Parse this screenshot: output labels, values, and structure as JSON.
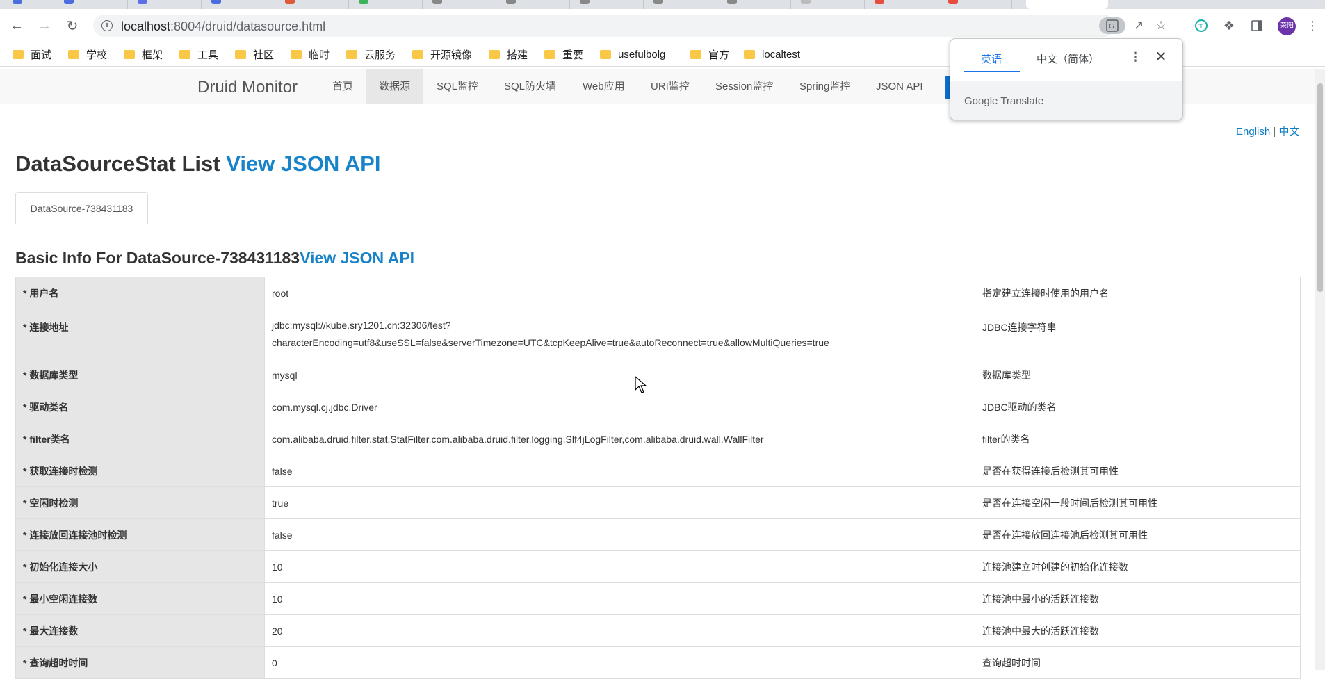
{
  "browser": {
    "url_host": "localhost",
    "url_rest": ":8004/druid/datasource.html",
    "profile_initials": "荣阳"
  },
  "bookmarks": [
    "面试",
    "学校",
    "框架",
    "工具",
    "社区",
    "临时",
    "云服务",
    "开源镜像",
    "搭建",
    "重要",
    "usefulbolg",
    "官方",
    "localtest"
  ],
  "druid_nav": {
    "brand": "Druid Monitor",
    "items": [
      "首页",
      "数据源",
      "SQL监控",
      "SQL防火墙",
      "Web应用",
      "URI监控",
      "Session监控",
      "Spring监控",
      "JSON API"
    ],
    "active_index": 1
  },
  "lang": {
    "english": "English",
    "sep": " | ",
    "chinese": "中文"
  },
  "page": {
    "title": "DataSourceStat List ",
    "title_link": "View JSON API",
    "datasource_tab": "DataSource-738431183",
    "subtitle": "Basic Info For DataSource-738431183",
    "subtitle_link": "View JSON API"
  },
  "rows": [
    {
      "label": "* 用户名",
      "value": "root",
      "desc": "指定建立连接时使用的用户名"
    },
    {
      "label": "* 连接地址",
      "value": "jdbc:mysql://kube.sry1201.cn:32306/test?",
      "value2": "characterEncoding=utf8&useSSL=false&serverTimezone=UTC&tcpKeepAlive=true&autoReconnect=true&allowMultiQueries=true",
      "desc": "JDBC连接字符串"
    },
    {
      "label": "* 数据库类型",
      "value": "mysql",
      "desc": "数据库类型"
    },
    {
      "label": "* 驱动类名",
      "value": "com.mysql.cj.jdbc.Driver",
      "desc": "JDBC驱动的类名"
    },
    {
      "label": "* filter类名",
      "value": "com.alibaba.druid.filter.stat.StatFilter,com.alibaba.druid.filter.logging.Slf4jLogFilter,com.alibaba.druid.wall.WallFilter",
      "desc": "filter的类名"
    },
    {
      "label": "* 获取连接时检测",
      "value": "false",
      "desc": "是否在获得连接后检测其可用性"
    },
    {
      "label": "* 空闲时检测",
      "value": "true",
      "desc": "是否在连接空闲一段时间后检测其可用性"
    },
    {
      "label": "* 连接放回连接池时检测",
      "value": "false",
      "desc": "是否在连接放回连接池后检测其可用性"
    },
    {
      "label": "* 初始化连接大小",
      "value": "10",
      "desc": "连接池建立时创建的初始化连接数"
    },
    {
      "label": "* 最小空闲连接数",
      "value": "10",
      "desc": "连接池中最小的活跃连接数"
    },
    {
      "label": "* 最大连接数",
      "value": "20",
      "desc": "连接池中最大的活跃连接数"
    },
    {
      "label": "* 查询超时时间",
      "value": "0",
      "desc": "查询超时时间"
    }
  ],
  "translate_popup": {
    "tab_source": "英语",
    "tab_target": "中文（简体）",
    "brand": "Google Translate"
  },
  "colors": {
    "link": "#1883c9",
    "nav_active": "#e7e7e7",
    "label_bg": "#e6e6e6",
    "translate_accent": "#1a73e8"
  },
  "icons": [
    "back-icon",
    "forward-icon",
    "reload-icon",
    "info-icon",
    "translate-icon",
    "share-icon",
    "star-icon",
    "extension-icon",
    "puzzle-icon",
    "sidepanel-icon",
    "more-vert-icon",
    "folder-icon",
    "close-icon",
    "mouse-cursor-icon"
  ]
}
